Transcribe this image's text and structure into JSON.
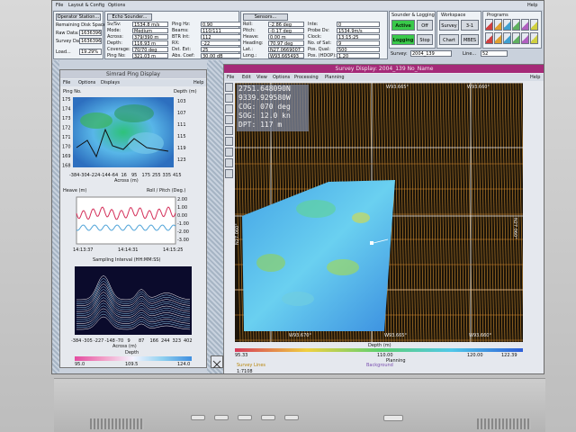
{
  "screen": {
    "help_top": "Help",
    "menu": [
      "File",
      "Layout & Config",
      "Options"
    ],
    "operator_station": "Operator Station...",
    "remaining_disk": "Remaining Disk Space",
    "raw_data_label": "Raw Data:",
    "raw_data_value": "1636396",
    "survey_data_label": "Survey Data:",
    "survey_data_value": "1636396",
    "load_label": "Load...",
    "load_value": "19.29%",
    "echo_sounder": "Echo Sounder...",
    "params": [
      {
        "k": "Sv/Sv:",
        "v": "1534.8 m/s"
      },
      {
        "k": "Mode:",
        "v": "Medium"
      },
      {
        "k": "Across:",
        "v": "379/390 m"
      },
      {
        "k": "Depth:",
        "v": "116.93 m"
      },
      {
        "k": "Coverage:",
        "v": "70/70 deg"
      },
      {
        "k": "Ping No:",
        "v": "321.03 m"
      }
    ],
    "params2": [
      {
        "k": "Ping Hz:",
        "v": "0.90"
      },
      {
        "k": "Beams:",
        "v": "110/111"
      },
      {
        "k": "BTR Int:",
        "v": "112"
      },
      {
        "k": "RX:",
        "v": "-22"
      },
      {
        "k": "Dst. Est:",
        "v": "25"
      },
      {
        "k": "Abs. Coef:",
        "v": "30.00 dB"
      }
    ],
    "sensors_title": "Sensors...",
    "sensors": [
      {
        "k": "Roll:",
        "v": "-2.86 deg"
      },
      {
        "k": "Pitch:",
        "v": "-0.17 deg"
      },
      {
        "k": "Heave:",
        "v": "0.00 m"
      },
      {
        "k": "Heading:",
        "v": "70.97 deg"
      },
      {
        "k": "Lat.:",
        "v": "N27.0669007"
      },
      {
        "k": "Long.:",
        "v": "W93.665493"
      }
    ],
    "sensors2": [
      {
        "k": "Inte:",
        "v": "0"
      },
      {
        "k": "Probe Dv:",
        "v": "1534.9m/s"
      },
      {
        "k": "Clock:",
        "v": "13:15:25"
      },
      {
        "k": "No. of Sat:",
        "v": "9"
      },
      {
        "k": "Pos. Qual:",
        "v": "500"
      },
      {
        "k": "Pos. (HDOP):",
        "v": "1.20"
      }
    ],
    "sounder_logging": "Sounder & Logging",
    "active": "Active",
    "off": "Off",
    "logging": "Logging",
    "stop": "Stop",
    "workspace": "Workspace",
    "ws_buttons": [
      "Survey",
      "3-1",
      "Chart",
      "MBES"
    ],
    "programs": "Programs",
    "survey_label": "Survey:",
    "survey_value": "2004_139",
    "line_label": "Line...",
    "line_value": "52"
  },
  "ping_window": {
    "title": "Simrad Ping Display",
    "menu": [
      "File",
      "Options",
      "Displays",
      "Help"
    ],
    "ping_no": "Ping No.",
    "depth_m": "Depth (m)",
    "y_left": [
      "175",
      "174",
      "173",
      "172",
      "171",
      "170",
      "169",
      "168"
    ],
    "y_right": [
      "103",
      "107",
      "111",
      "115",
      "119",
      "123"
    ],
    "x_ticks": [
      "-384",
      "-304",
      "-224",
      "-144",
      "-64",
      "16",
      "95",
      "175",
      "255",
      "335",
      "415"
    ],
    "x_label": "Across (m)",
    "heave_label": "Heave (m)",
    "rollpitch_label": "Roll / Pitch (Deg.)",
    "rp_ticks": [
      "2.00",
      "1.00",
      "0.00",
      "-1.00",
      "-2.00",
      "-3.00"
    ],
    "time_ticks": [
      "14:13:37",
      "14:14:31",
      "14:15:25"
    ],
    "sampling": "Sampling Interval (HH:MM:SS)",
    "wf_x_ticks": [
      "-384",
      "-305",
      "-227",
      "-148",
      "-70",
      "9",
      "87",
      "166",
      "244",
      "323",
      "402"
    ],
    "wf_x_label": "Across (m)",
    "depth_scale_label": "Depth",
    "depth_scale": [
      "95.0",
      "109.5",
      "124.0"
    ]
  },
  "survey_window": {
    "title": "Survey Display: 2004_139 No_Name",
    "menu": [
      "File",
      "Edit",
      "View",
      "Options",
      "Processing",
      "Planning",
      "Help"
    ],
    "info": [
      "2751.648090N",
      "9339.929580W",
      "COG: 070 deg",
      "SOG: 12.0 kn",
      "DPT:  117 m"
    ],
    "top_labels": [
      "W93.665°",
      "W93.660°"
    ],
    "bottom_labels": [
      "W93.670°",
      "W93.665°",
      "W93.660°"
    ],
    "left_label": "N27.060°",
    "right_label": "N27.060°",
    "scale_title": "Depth (m)",
    "scale_ticks": [
      "95.33",
      "110.00",
      "120.00",
      "122.39"
    ],
    "legend": [
      "Planning",
      "Survey Lines",
      "Background"
    ],
    "scale_ratio": "1:7108",
    "colors": {
      "grid": "#f0f0f0",
      "tracks": "#c8892e",
      "background": "#1c1409"
    }
  },
  "monitor": {
    "brand_buttons": 5
  }
}
